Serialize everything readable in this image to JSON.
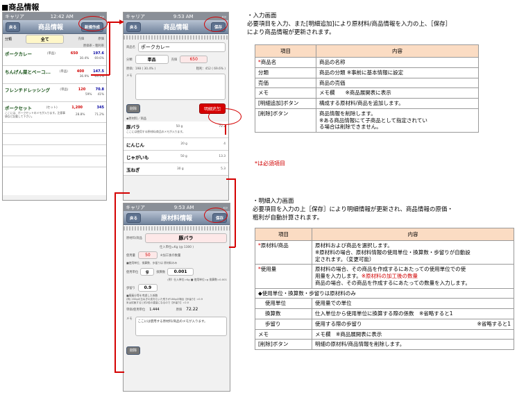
{
  "heading": "■商品情報",
  "phone1": {
    "carrier": "キャリア",
    "time": "12:42 AM",
    "back": "戻る",
    "title": "商品情報",
    "add": "新規作成",
    "bar": {
      "cat_label": "分類",
      "cat_value": "全て",
      "h1": "売価",
      "h2": "原価",
      "h3": "原価率・粗利率"
    },
    "items": [
      {
        "name": "ポークカレー",
        "cat": "(単品)",
        "price": "650",
        "cost": "197.6",
        "r1": "30.4%",
        "r2": "69.6%"
      },
      {
        "name": "ちんげん菜とベーコ...",
        "cat": "(単品)",
        "price": "400",
        "cost": "147.5",
        "r1": "36.9%",
        "r2": "63.1%"
      },
      {
        "name": "フレンチドレッシング",
        "cat": "(単品)",
        "price": "120",
        "cost": "70.8",
        "r1": "59%",
        "r2": "41%"
      },
      {
        "name": "ポークセット",
        "cat": "(セット)",
        "price": "1,200",
        "cost": "345",
        "r1": "28.8%",
        "r2": "71.2%",
        "note": "ここには、ポークセットのメモが入ります。注意事項など記載して下さい。"
      }
    ]
  },
  "phone2": {
    "carrier": "キャリア",
    "time": "9:53 AM",
    "back": "戻る",
    "title": "商品情報",
    "save": "保存",
    "name_label": "商品名",
    "name_value": "ポークカレー",
    "cat_label": "分類",
    "cat_value": "単品",
    "price_label": "売価",
    "price_value": "650",
    "cost_line": "原価：198 ( 30.4% )",
    "profit_line": "粗利：452 ( 69.6% )",
    "memo_label": "メモ",
    "delete": "削除",
    "add_detail": "明細追加",
    "list_header": "◆原材料／商品",
    "rows": [
      {
        "name": "豚バラ",
        "note": "ここには使用する原材料/商品のメモが入ります。",
        "qty": "50 g",
        "val": "72.2"
      },
      {
        "name": "にんじん",
        "qty": "20 g",
        "val": "4"
      },
      {
        "name": "じゃがいも",
        "qty": "50 g",
        "val": "13.3"
      },
      {
        "name": "玉ねぎ",
        "qty": "30 g",
        "val": "5.3"
      }
    ]
  },
  "phone3": {
    "carrier": "キャリア",
    "time": "9:53 AM",
    "back": "戻る",
    "title": "原材料情報",
    "save": "保存",
    "mat_label": "原材料/商品",
    "mat_value": "豚バラ",
    "unit_price": "仕入単位=Kg (@ 1300 )",
    "use_label": "使用量",
    "use_value": "50",
    "use_note": "※加工後の数量",
    "use_note2": "■使用単位、換算数、歩留りは 原材料のみ",
    "unit_label": "使用単位",
    "unit_value": "g",
    "conv_label": "換算数",
    "conv_value": "0.001",
    "conv_note": "(例）仕入単位=Kg ■ 使用単位=g 換算数=0.001",
    "yield_label": "歩留り",
    "yield_value": "0.9",
    "yield_note": "■廃棄分等を考慮した係数",
    "ex1": "(例) 200gの玉ねぎの皮をむいた残りが180gの場合【歩留り】=0.9",
    "ex2": "米は炊飯すると約2倍の重量になるので【歩留り】=2.0",
    "unit_cost_label": "単価/使用単位",
    "unit_cost_value": "1.444",
    "cost_label": "原価",
    "cost_value": "72.22",
    "memo_label": "メモ",
    "memo_value": "ここには使用する原材料/商品のメモが入ります。",
    "delete": "削除"
  },
  "section1": {
    "title": "・入力画面",
    "desc": [
      "必要項目を入力、また[明細追加]により原材料/商品情報を入力の上、［保存］",
      "により商品情報が更新されます。"
    ],
    "h_item": "項目",
    "h_content": "内容",
    "rows": [
      {
        "item": "*商品名",
        "req": true,
        "content": [
          "商品の名称"
        ]
      },
      {
        "item": "分類",
        "content": [
          "商品の分類 ※事前に基本情報に設定"
        ]
      },
      {
        "item": "売価",
        "content": [
          "商品の売価"
        ]
      },
      {
        "item": "メモ",
        "content": [
          "メモ欄　　※商品展開表に表示"
        ]
      },
      {
        "item": "[明細追加]ボタン",
        "content": [
          "構成する原材料/商品を追加します。"
        ]
      },
      {
        "item": "[削除]ボタン",
        "content": [
          "商品情報を削除します。",
          "※ある商品情報にて子商品として指定されてい",
          "る場合は削除できません。"
        ]
      }
    ],
    "note": "*は必須項目"
  },
  "section2": {
    "title": "・明細入力画面",
    "desc": [
      "必要項目を入力の上［保存］により明細情報が更新され、商品情報の原価・",
      "粗利が自動計算されます。"
    ],
    "h_item": "項目",
    "h_content": "内容",
    "r1_item": "*原材料/商品",
    "r1_content": [
      "原材料および商品を選択します。",
      "※原材料の場合、原材料情報の使用単位・換算数・歩留りが自動設",
      "定されます。（変更可能）"
    ],
    "r2_item": "*使用量",
    "r2_a": "原材料の場合、その商品を作成するにあたっての使用単位での使",
    "r2_b": "用量を入力します。",
    "r2_red": "※原材料の加工後の数量",
    "r2_c": "商品の場合、その商品を作成するにあたっての数量を入力します。",
    "group": "◆使用単位・換算数・歩留りは原材料のみ",
    "sub": [
      {
        "item": "使用単位",
        "content": "使用量での単位",
        "extra": ""
      },
      {
        "item": "換算数",
        "content": "仕入単位から使用単位に換算する際の係数",
        "extra": "※省略すると1"
      },
      {
        "item": "歩留り",
        "content": "使用する際の歩留り",
        "extra": "※省略すると1"
      }
    ],
    "r_memo_item": "メモ",
    "r_memo_content": "メモ欄　※商品展開表に表示",
    "r_del_item": "[削除]ボタン",
    "r_del_content": "明細の原材料/商品情報を削除します。"
  }
}
